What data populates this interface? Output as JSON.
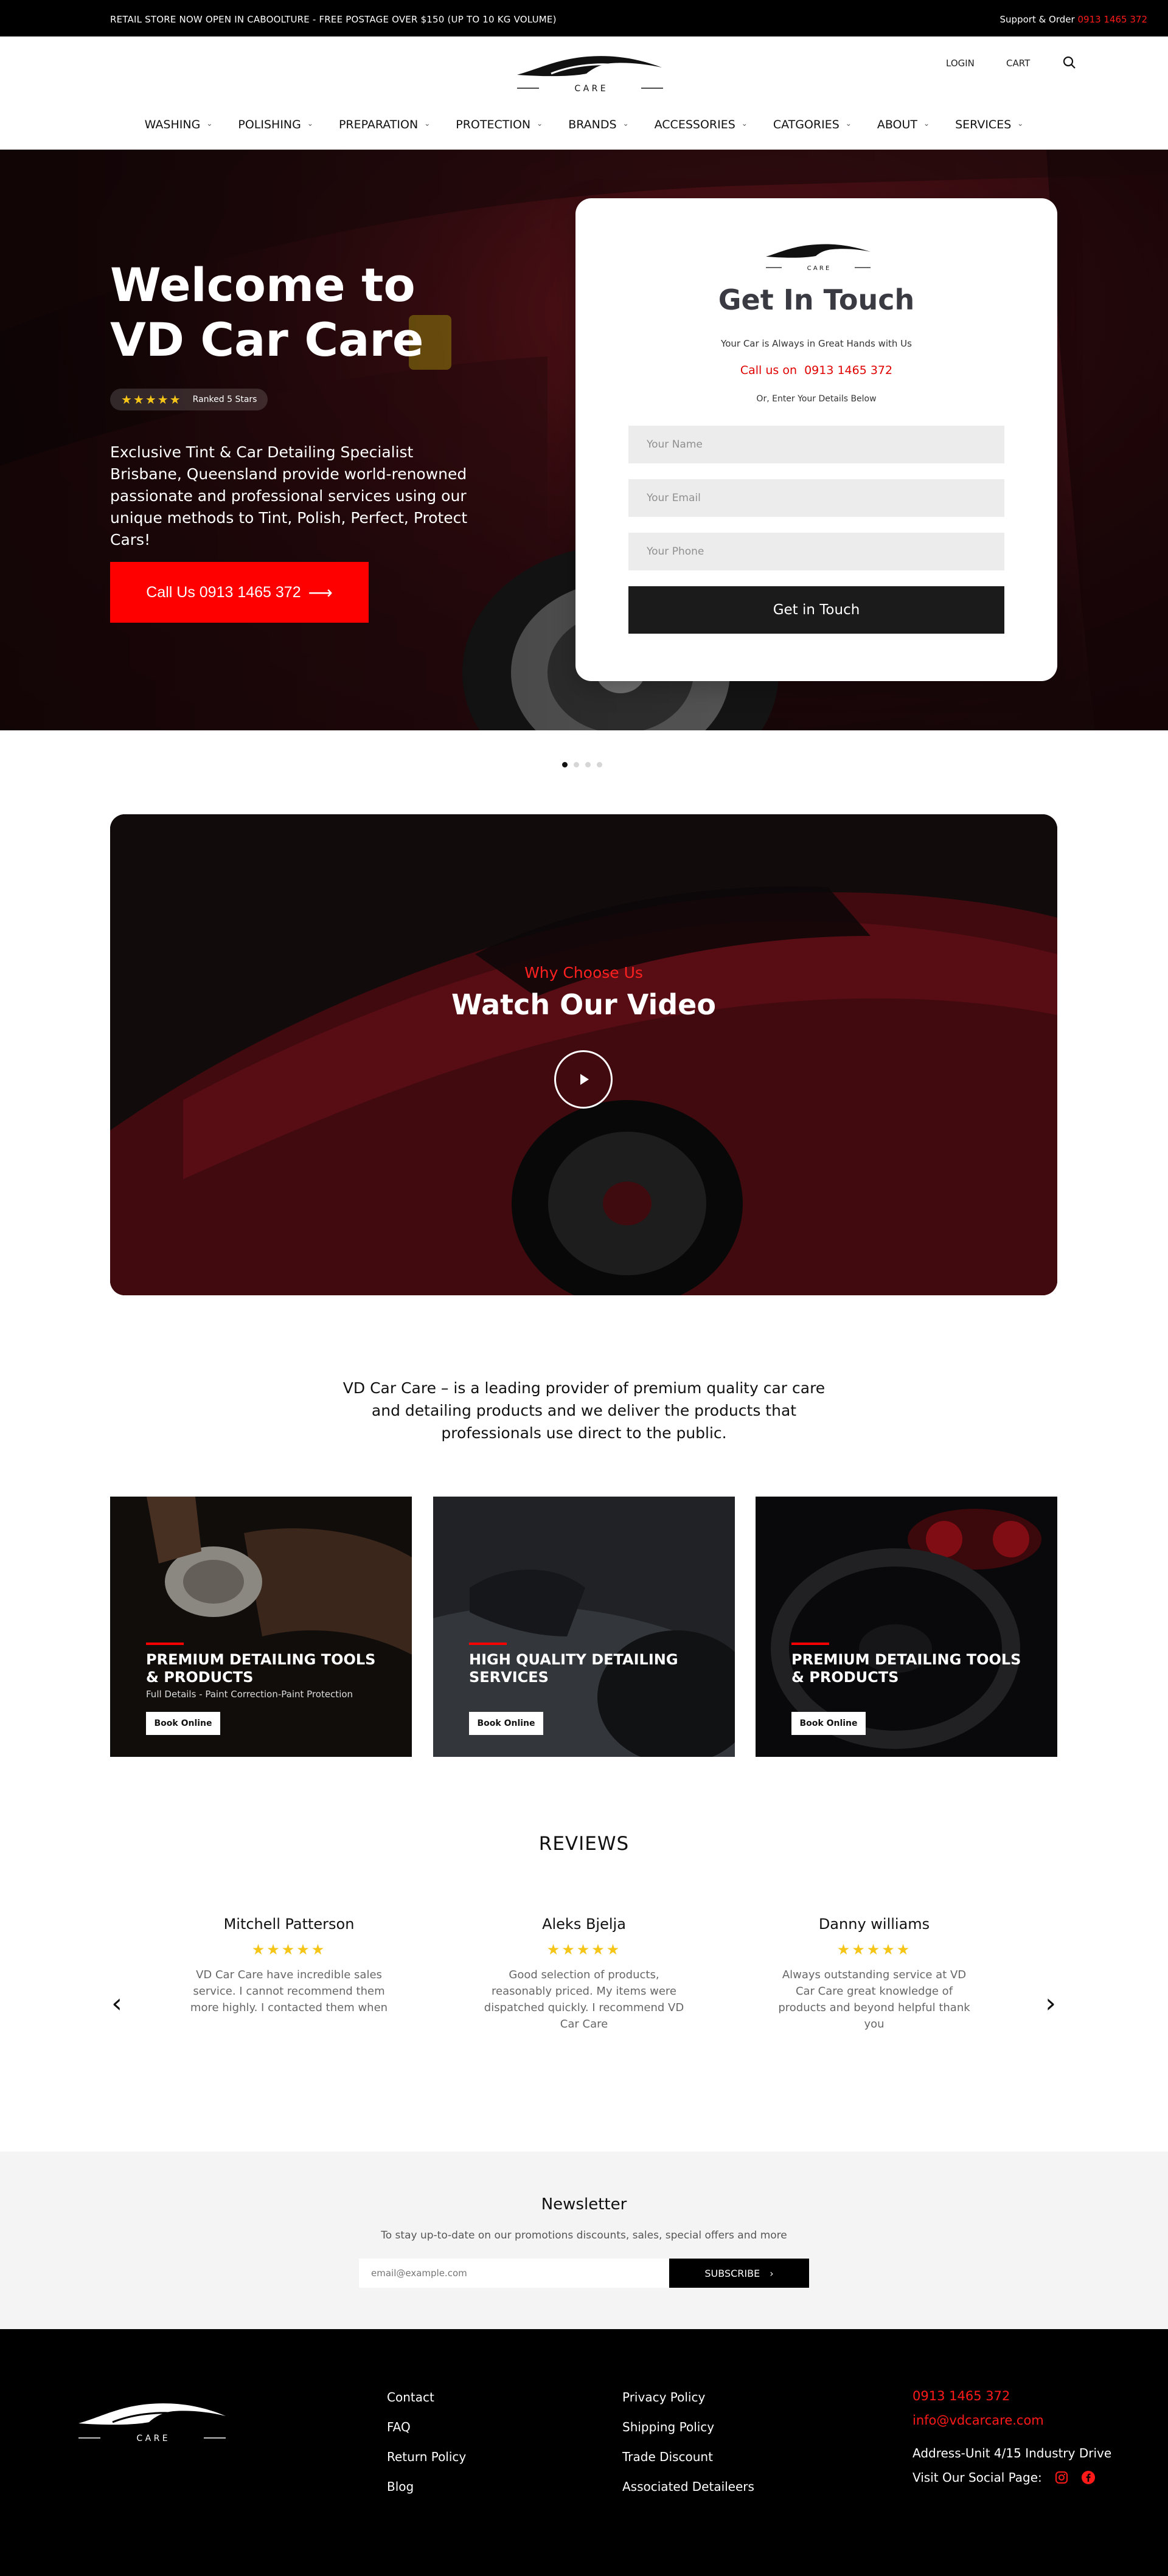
{
  "topbar": {
    "promo": "RETAIL STORE NOW OPEN IN CABOOLTURE - FREE POSTAGE OVER $150 (UP TO 10 KG VOLUME)",
    "support_label": "Support & Order",
    "support_phone": "0913 1465 372"
  },
  "header": {
    "logo_text": "C A R E",
    "login": "LOGIN",
    "cart": "CART",
    "search_icon": "search-icon"
  },
  "nav": {
    "items": [
      {
        "label": "WASHING"
      },
      {
        "label": "POLISHING"
      },
      {
        "label": "PREPARATION"
      },
      {
        "label": "PROTECTION"
      },
      {
        "label": "BRANDS"
      },
      {
        "label": "ACCESSORIES"
      },
      {
        "label": "CATGORIES"
      },
      {
        "label": "ABOUT"
      },
      {
        "label": "SERVICES"
      }
    ]
  },
  "hero": {
    "title_line1": "Welcome to",
    "title_line2": " VD  Car Care",
    "stars": "★★★★★",
    "rank_label": "Ranked 5 Stars",
    "description": "Exclusive Tint & Car Detailing Specialist Brisbane, Queensland provide world-renowned passionate and professional services using our unique methods to Tint, Polish, Perfect, Protect Cars!",
    "call_button": "Call Us 0913 1465 372",
    "call_arrow": "⟶"
  },
  "contact_card": {
    "title": "Get In Touch",
    "tagline": "Your Car is Always in Great Hands with Us",
    "call_label": "Call us on",
    "call_number": "0913 1465 372",
    "or_text": "Or, Enter Your Details Below",
    "name_placeholder": "Your Name",
    "email_placeholder": "Your Email",
    "phone_placeholder": "Your Phone",
    "submit": "Get in Touch"
  },
  "slider": {
    "count": 4,
    "active": 0
  },
  "video": {
    "eyebrow": "Why Choose Us",
    "title": "Watch Our Video",
    "play_icon": "play-icon"
  },
  "about": {
    "text": "VD Car Care – is a leading provider of premium quality car care and detailing products and we deliver the products that professionals use direct to the public."
  },
  "services": [
    {
      "title": "PREMIUM DETAILING TOOLS & PRODUCTS",
      "subtitle": "Full Details - Paint Correction-Paint Protection",
      "button": "Book Online"
    },
    {
      "title": "HIGH QUALITY DETAILING SERVICES",
      "subtitle": "",
      "button": "Book Online"
    },
    {
      "title": "PREMIUM DETAILING TOOLS & PRODUCTS",
      "subtitle": "",
      "button": "Book Online"
    }
  ],
  "reviews": {
    "title": "REVIEWS",
    "items": [
      {
        "name": "Mitchell Patterson",
        "stars": "★★★★★",
        "text": "VD Car Care have incredible sales service. I cannot recommend them more highly. I contacted them when"
      },
      {
        "name": "Aleks Bjelja",
        "stars": "★★★★★",
        "text": "Good selection of products, reasonably priced. My items were dispatched quickly. I recommend VD  Car Care"
      },
      {
        "name": "Danny williams",
        "stars": "★★★★★",
        "text": "Always outstanding service at VD Car Care great knowledge of products and beyond helpful thank you"
      }
    ],
    "prev": "‹",
    "next": "›"
  },
  "newsletter": {
    "title": "Newsletter",
    "subtitle": "To stay up-to-date on our promotions discounts, sales, special offers and more",
    "placeholder": "email@example.com",
    "button": "SUBSCRIBE",
    "button_icon": "›"
  },
  "footer": {
    "col1": [
      "Contact",
      "FAQ",
      "Return Policy",
      "Blog"
    ],
    "col2": [
      "Privacy Policy",
      "Shipping Policy",
      "Trade Discount",
      "Associated Detaileers"
    ],
    "phone": "0913 1465 372",
    "email": "info@vdcarcare.com",
    "address": "Address-Unit 4/15 Industry Drive",
    "social_label": "Visit Our Social Page:"
  },
  "colors": {
    "accent": "#ff0000",
    "dark": "#000000",
    "star": "#f5c518"
  }
}
